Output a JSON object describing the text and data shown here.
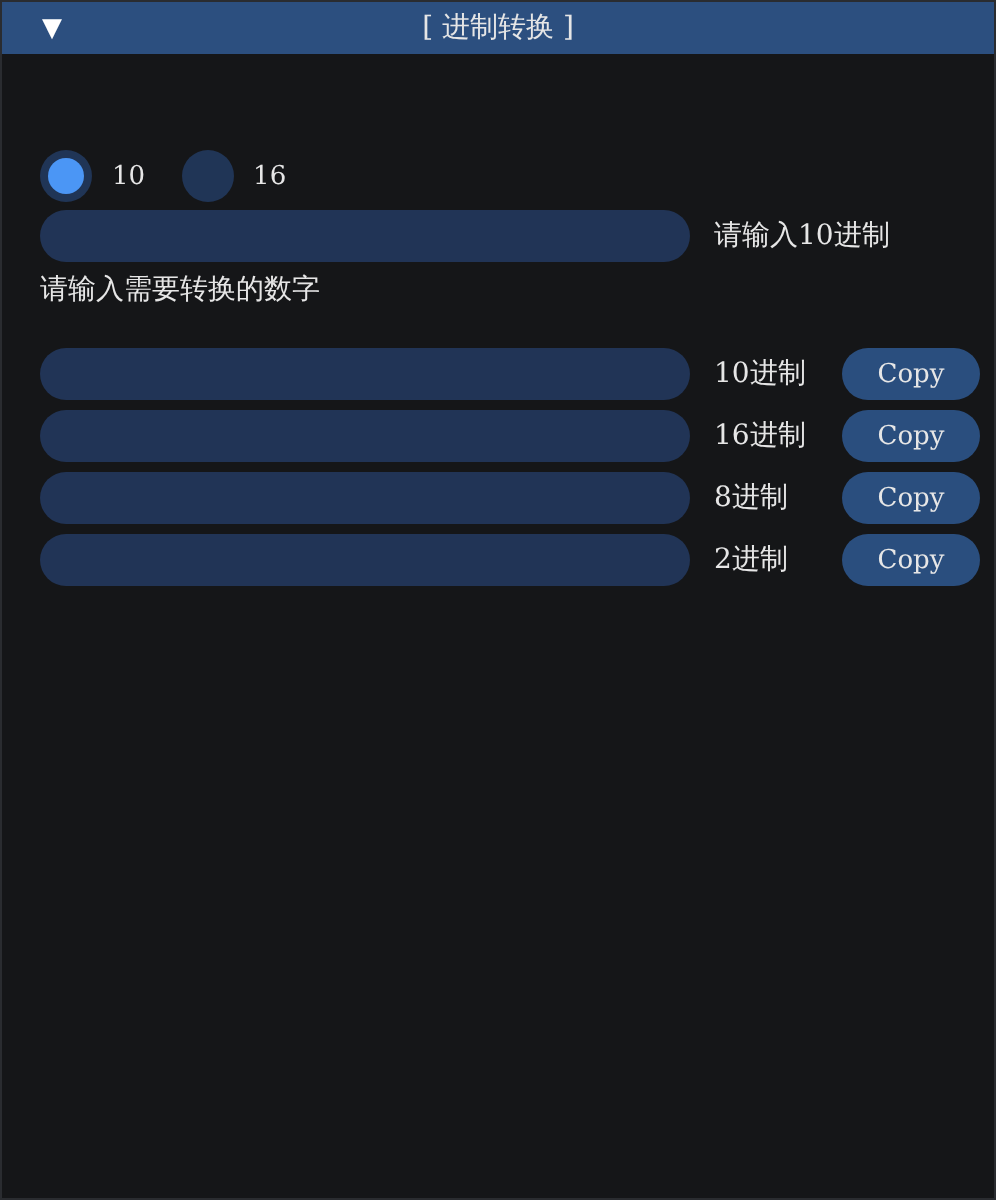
{
  "window": {
    "title": "[ 进制转换 ]",
    "collapse_glyph": "▼"
  },
  "radix_options": [
    {
      "label": "10",
      "selected": true
    },
    {
      "label": "16",
      "selected": false
    }
  ],
  "input": {
    "label": "请输入10进制"
  },
  "hint": "请输入需要转换的数字",
  "outputs": [
    {
      "label": "10进制",
      "button": "Copy"
    },
    {
      "label": "16进制",
      "button": "Copy"
    },
    {
      "label": "8进制",
      "button": "Copy"
    },
    {
      "label": "2进制",
      "button": "Copy"
    }
  ]
}
